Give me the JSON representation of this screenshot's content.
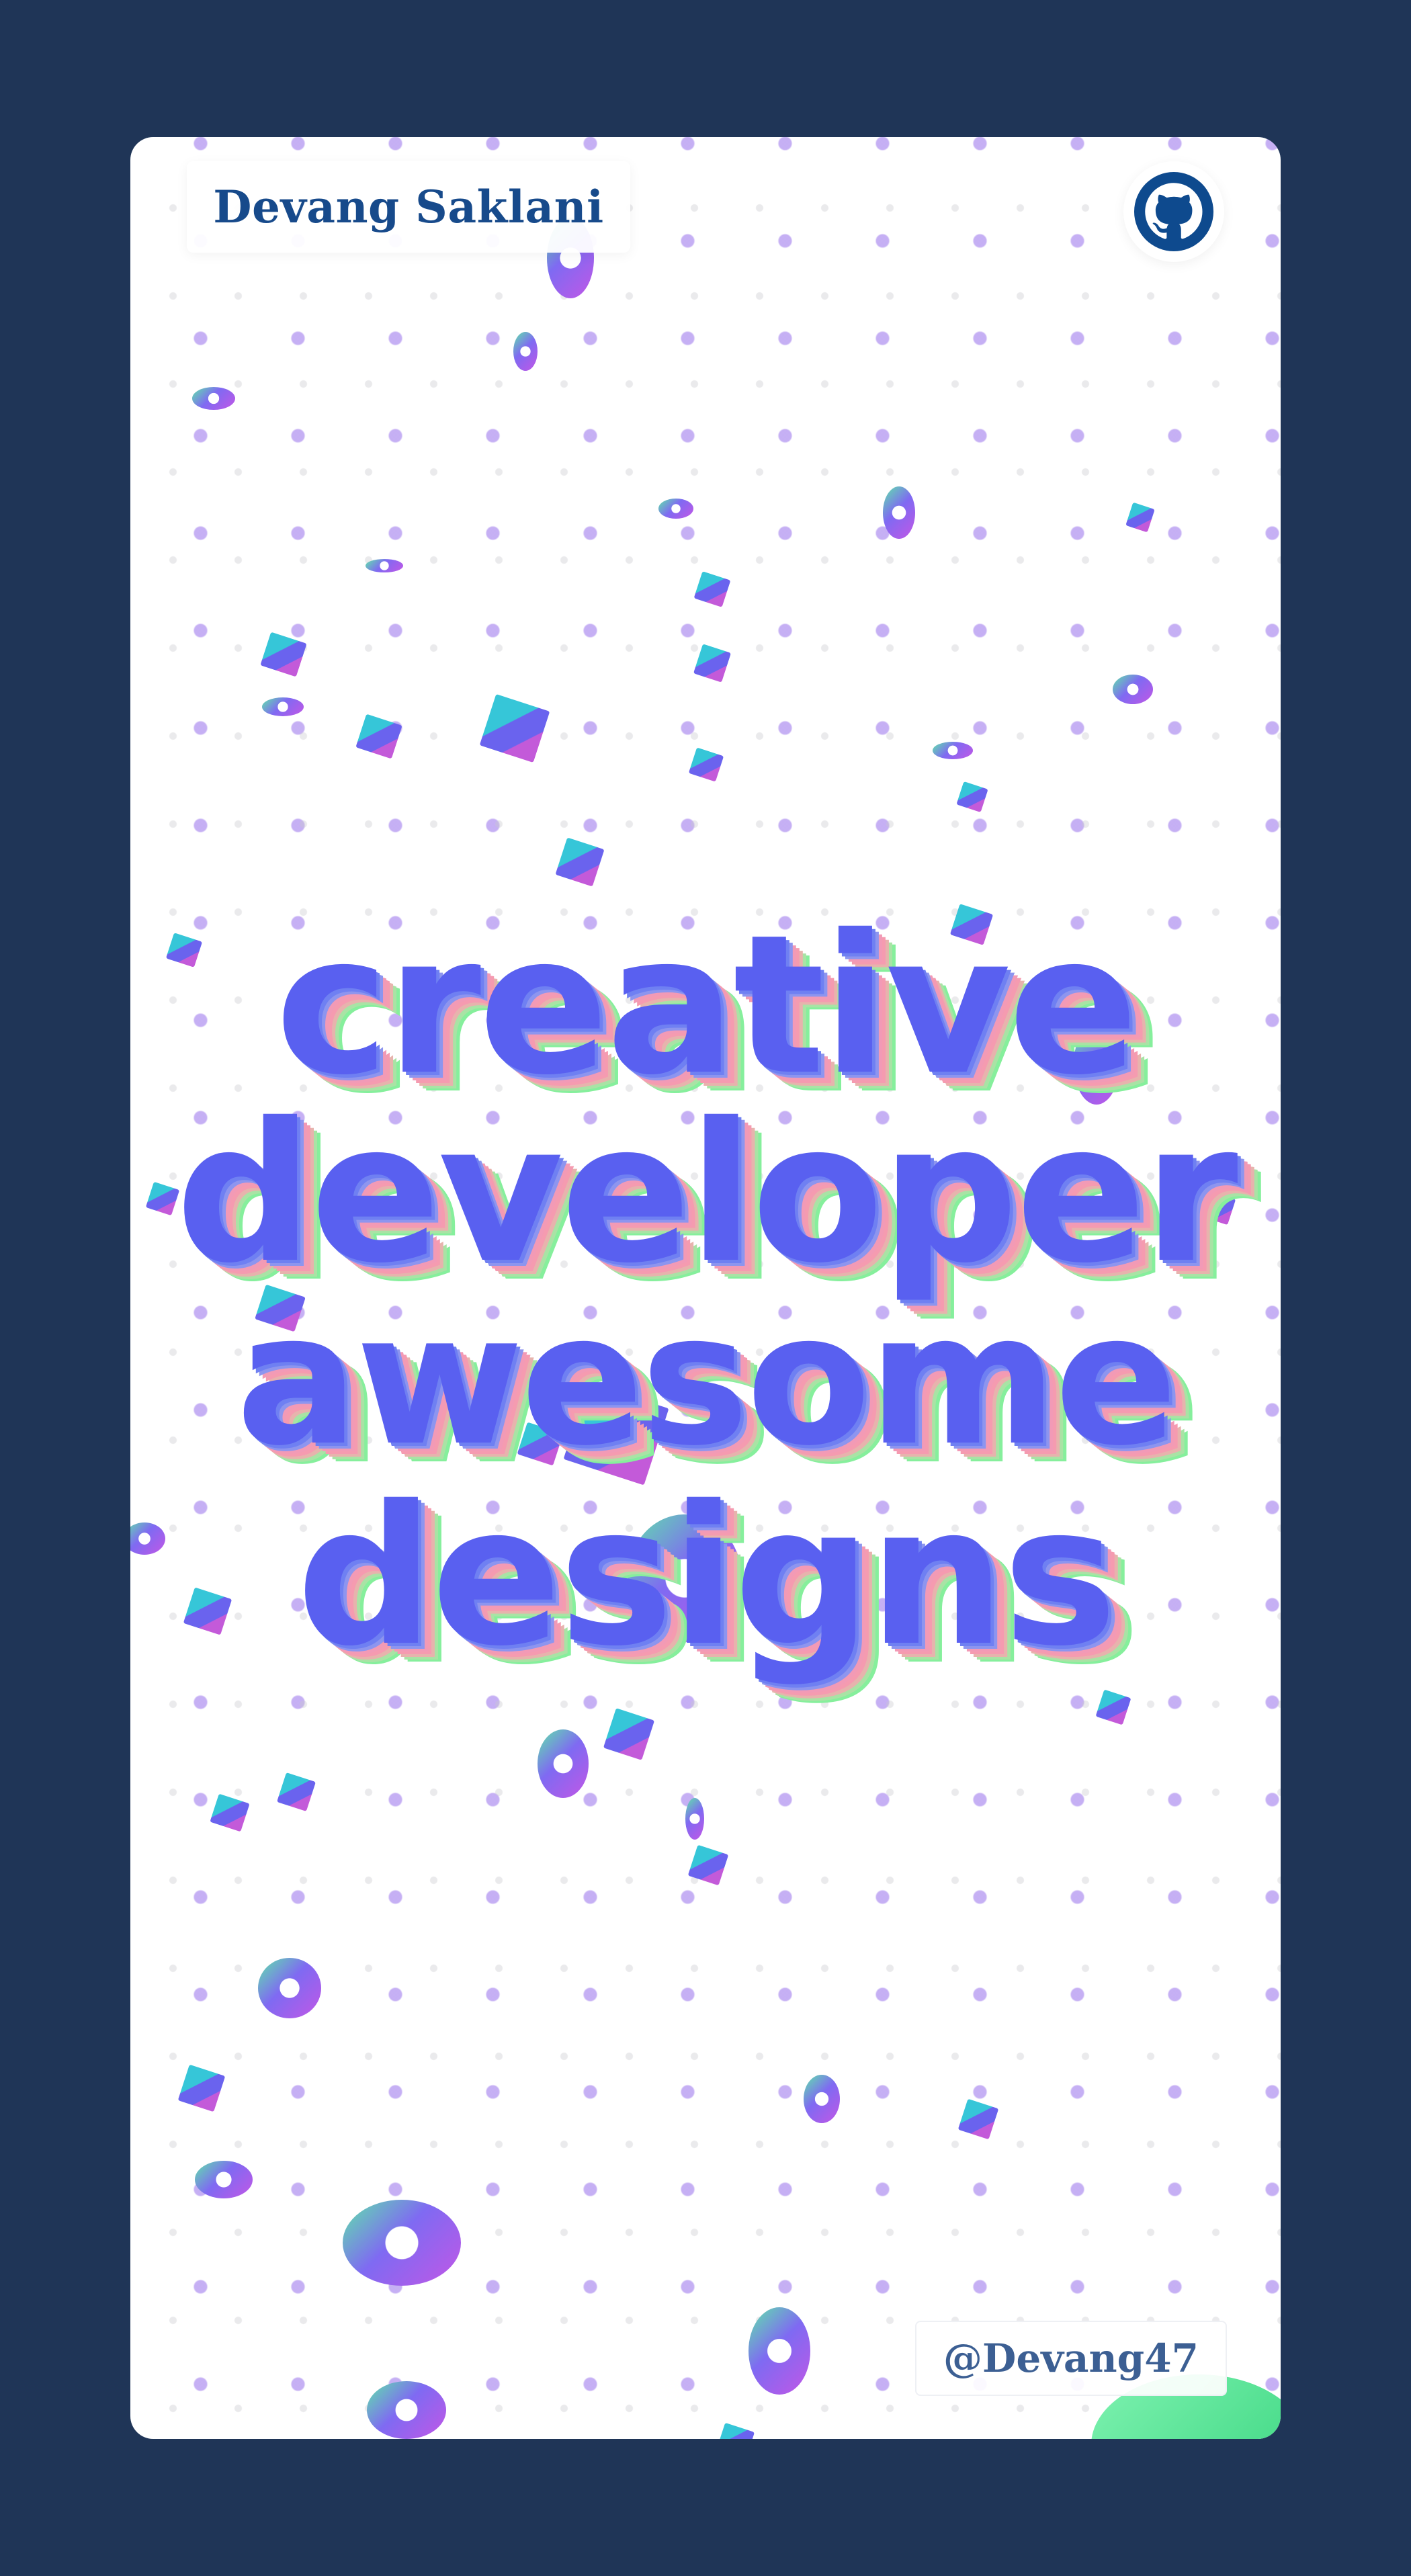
{
  "header": {
    "name": "Devang Saklani",
    "github_icon": "github-icon"
  },
  "hero": {
    "lines": [
      "creative",
      "developer",
      "awesome",
      "designs"
    ]
  },
  "footer": {
    "handle": "@Devang47"
  },
  "colors": {
    "page_background": "#1f3557",
    "card_background": "#ffffff",
    "name_text": "#174a8b",
    "handle_text": "#3c5f93",
    "hero_face": "#5960f0",
    "hero_side_pink": "#f29ab6",
    "hero_side_green": "#86ef9c",
    "dot_color": "#966eeb"
  }
}
